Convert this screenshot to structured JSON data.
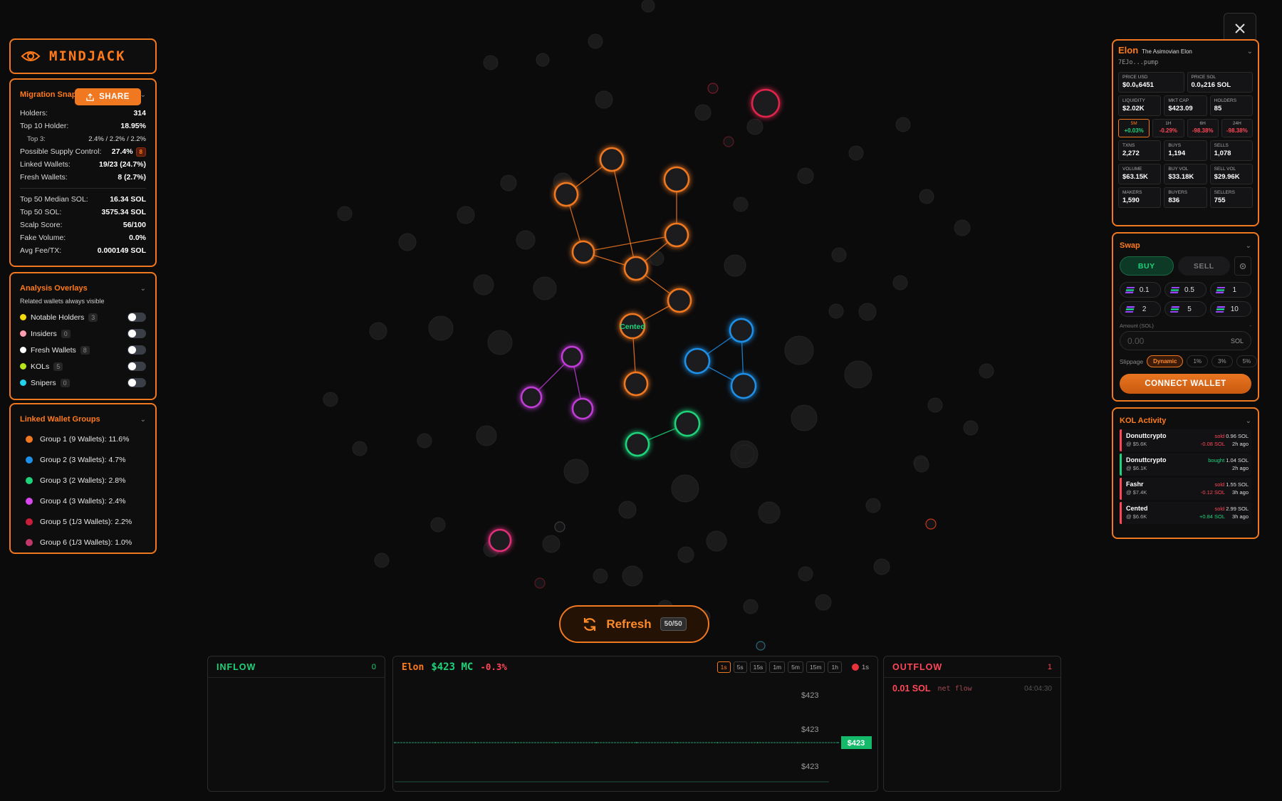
{
  "app": {
    "brand": "MINDJACK"
  },
  "migration": {
    "title": "Migration Snap",
    "share_label": "SHARE",
    "stats": [
      {
        "label": "Holders:",
        "value": "314"
      },
      {
        "label": "Top 10 Holder:",
        "value": "18.95%"
      },
      {
        "label": "Top 3:",
        "value": "2.4% / 2.2% / 2.2%",
        "sub": true
      },
      {
        "label": "Possible Supply Control:",
        "value": "27.4%",
        "badge": "8"
      },
      {
        "label": "Linked Wallets:",
        "value": "19/23 (24.7%)"
      },
      {
        "label": "Fresh Wallets:",
        "value": "8 (2.7%)"
      }
    ],
    "stats2": [
      {
        "label": "Top 50 Median SOL:",
        "value": "16.34 SOL"
      },
      {
        "label": "Top 50 SOL:",
        "value": "3575.34 SOL"
      },
      {
        "label": "Scalp Score:",
        "value": "56/100"
      },
      {
        "label": "Fake Volume:",
        "value": "0.0%"
      },
      {
        "label": "Avg Fee/TX:",
        "value": "0.000149 SOL"
      }
    ]
  },
  "overlays": {
    "title": "Analysis Overlays",
    "subtitle": "Related wallets always visible",
    "items": [
      {
        "label": "Notable Holders",
        "count": "3",
        "color": "#f5d90a"
      },
      {
        "label": "Insiders",
        "count": "0",
        "color": "#ff9db0"
      },
      {
        "label": "Fresh Wallets",
        "count": "8",
        "color": "#ffffff"
      },
      {
        "label": "KOLs",
        "count": "5",
        "color": "#b6e51a"
      },
      {
        "label": "Snipers",
        "count": "0",
        "color": "#22d3ee"
      }
    ]
  },
  "groups": {
    "title": "Linked Wallet Groups",
    "items": [
      {
        "label": "Group 1 (9 Wallets): 11.6%",
        "color": "#f07820"
      },
      {
        "label": "Group 2 (3 Wallets): 4.7%",
        "color": "#1e90e8"
      },
      {
        "label": "Group 3 (2 Wallets): 2.8%",
        "color": "#1ed37a"
      },
      {
        "label": "Group 4 (3 Wallets): 2.4%",
        "color": "#d946ef"
      },
      {
        "label": "Group 5 (1/3 Wallets): 2.2%",
        "color": "#c81e3a"
      },
      {
        "label": "Group 6 (1/3 Wallets): 1.0%",
        "color": "#c0386a"
      }
    ]
  },
  "token": {
    "name": "Elon",
    "fullname": "The Asimovian Elon",
    "address": "7EJo...pump",
    "price_usd_label": "PRICE USD",
    "price_usd": "$0.0₆6451",
    "price_sol_label": "PRICE SOL",
    "price_sol": "0.0₈216 SOL",
    "liquidity_label": "LIQUIDITY",
    "liquidity": "$2.02K",
    "mktcap_label": "MKT CAP",
    "mktcap": "$423.09",
    "holders_label": "HOLDERS",
    "holders": "85",
    "timeframes": [
      {
        "k": "5M",
        "v": "+0.03%",
        "color": "#1ed37a",
        "active": true
      },
      {
        "k": "1H",
        "v": "-0.29%",
        "color": "#ff4757"
      },
      {
        "k": "6H",
        "v": "-98.38%",
        "color": "#ff4757"
      },
      {
        "k": "24H",
        "v": "-98.38%",
        "color": "#ff4757"
      }
    ],
    "txns_label": "TXNS",
    "txns": "2,272",
    "buys_label": "BUYS",
    "buys": "1,194",
    "sells_label": "SELLS",
    "sells": "1,078",
    "volume_label": "VOLUME",
    "volume": "$63.15K",
    "buyvol_label": "BUY VOL",
    "buyvol": "$33.18K",
    "sellvol_label": "SELL VOL",
    "sellvol": "$29.96K",
    "makers_label": "MAKERS",
    "makers": "1,590",
    "buyers_label": "BUYERS",
    "buyers": "836",
    "sellers_label": "SELLERS",
    "sellers": "755"
  },
  "swap": {
    "title": "Swap",
    "buy": "BUY",
    "sell": "SELL",
    "amounts": [
      "0.1",
      "0.5",
      "1",
      "2",
      "5",
      "10"
    ],
    "amount_label": "Amount (SOL)",
    "amount_placeholder": "0.00",
    "amount_unit": "SOL",
    "slippage_label": "Slippage",
    "slippage_options": [
      "Dynamic",
      "1%",
      "3%",
      "5%"
    ],
    "connect": "CONNECT WALLET"
  },
  "kol": {
    "title": "KOL Activity",
    "items": [
      {
        "name": "Donuttcrypto",
        "mc": "@ $5.6K",
        "action": "sold",
        "amount": "0.96 SOL",
        "pnl": "-0.08 SOL",
        "time": "2h ago",
        "side": "sell"
      },
      {
        "name": "Donuttcrypto",
        "mc": "@ $6.1K",
        "action": "bought",
        "amount": "1.04 SOL",
        "pnl": "",
        "time": "2h ago",
        "side": "buy"
      },
      {
        "name": "Fashr",
        "mc": "@ $7.4K",
        "action": "sold",
        "amount": "1.55 SOL",
        "pnl": "-0.12 SOL",
        "time": "3h ago",
        "side": "sell"
      },
      {
        "name": "Cented",
        "mc": "@ $6.6K",
        "action": "sold",
        "amount": "2.99 SOL",
        "pnl": "+0.84 SOL",
        "time": "3h ago",
        "side": "sell"
      }
    ]
  },
  "graph": {
    "kol_label": "Cented"
  },
  "refresh": {
    "label": "Refresh",
    "count": "50/50"
  },
  "inflow": {
    "title": "INFLOW",
    "count": "0"
  },
  "chart": {
    "token": "Elon",
    "mc": "$423 MC",
    "change": "-0.3%",
    "timeframes": [
      "1s",
      "5s",
      "15s",
      "1m",
      "5m",
      "15m",
      "1h"
    ],
    "live": "1s",
    "ticks": [
      "$423",
      "$423",
      "$423"
    ],
    "price_tag": "$423"
  },
  "chart_data": {
    "type": "line",
    "title": "Elon $423 MC -0.3%",
    "xlabel": "",
    "ylabel": "",
    "series": [
      {
        "values": [
          423,
          423,
          423,
          423,
          423,
          423,
          423,
          423,
          423,
          423,
          423,
          423
        ]
      }
    ]
  },
  "outflow": {
    "title": "OUTFLOW",
    "count": "1",
    "amount": "0.01 SOL",
    "label": "net flow",
    "time": "04:04:30"
  }
}
